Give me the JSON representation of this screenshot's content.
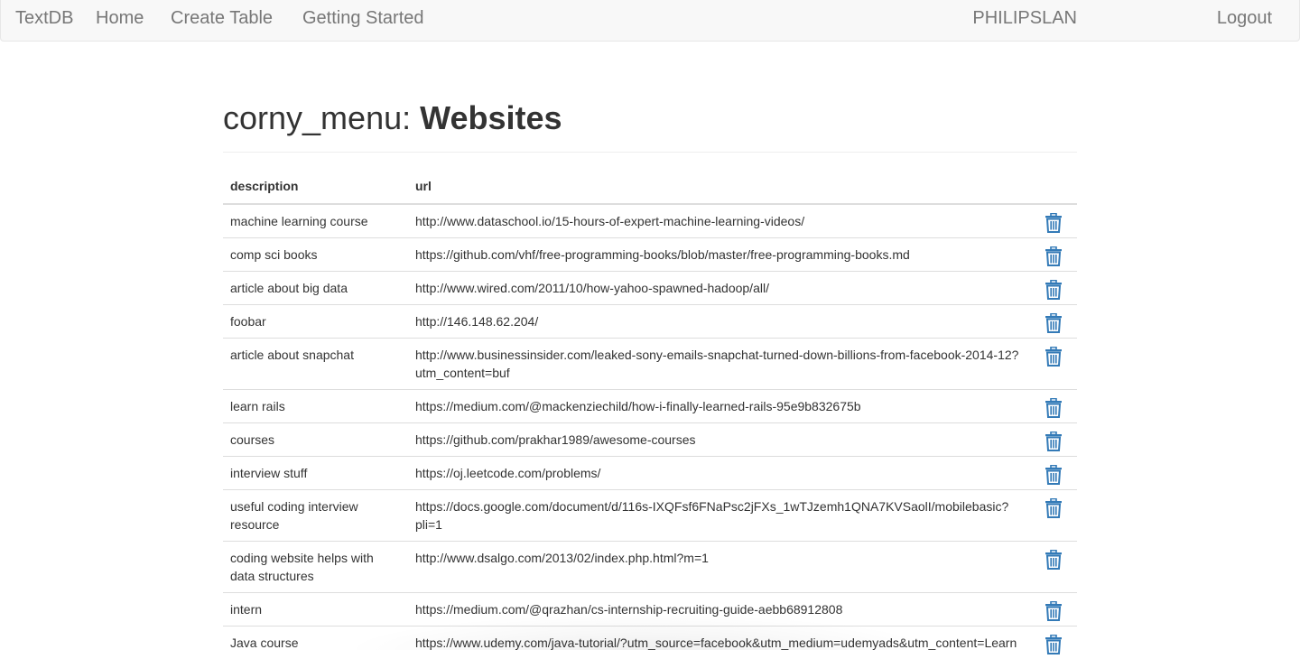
{
  "navbar": {
    "brand": "TextDB",
    "links": [
      "Home",
      "Create Table",
      "Getting Started"
    ],
    "user": "PHILIPSLAN",
    "logout": "Logout"
  },
  "page": {
    "db_name": "corny_menu:",
    "table_name": "Websites"
  },
  "table": {
    "headers": [
      "description",
      "url"
    ],
    "rows": [
      {
        "description": "machine learning course",
        "url": "http://www.dataschool.io/15-hours-of-expert-machine-learning-videos/"
      },
      {
        "description": "comp sci books",
        "url": "https://github.com/vhf/free-programming-books/blob/master/free-programming-books.md"
      },
      {
        "description": "article about big data",
        "url": "http://www.wired.com/2011/10/how-yahoo-spawned-hadoop/all/"
      },
      {
        "description": "foobar",
        "url": "http://146.148.62.204/"
      },
      {
        "description": "article about snapchat",
        "url": "http://www.businessinsider.com/leaked-sony-emails-snapchat-turned-down-billions-from-facebook-2014-12?utm_content=buf"
      },
      {
        "description": "learn rails",
        "url": "https://medium.com/@mackenziechild/how-i-finally-learned-rails-95e9b832675b"
      },
      {
        "description": "courses",
        "url": "https://github.com/prakhar1989/awesome-courses"
      },
      {
        "description": "interview stuff",
        "url": "https://oj.leetcode.com/problems/"
      },
      {
        "description": "useful coding interview resource",
        "url": "https://docs.google.com/document/d/116s-IXQFsf6FNaPsc2jFXs_1wTJzemh1QNA7KVSaolI/mobilebasic?pli=1"
      },
      {
        "description": "coding website helps with data structures",
        "url": "http://www.dsalgo.com/2013/02/index.php.html?m=1"
      },
      {
        "description": "intern",
        "url": "https://medium.com/@qrazhan/cs-internship-recruiting-guide-aebb68912808"
      },
      {
        "description": "Java course",
        "url": "https://www.udemy.com/java-tutorial/?utm_source=facebook&utm_medium=udemyads&utm_content=Learn"
      }
    ],
    "delete_icon": "trash-icon",
    "icon_color": "#337ab7"
  }
}
